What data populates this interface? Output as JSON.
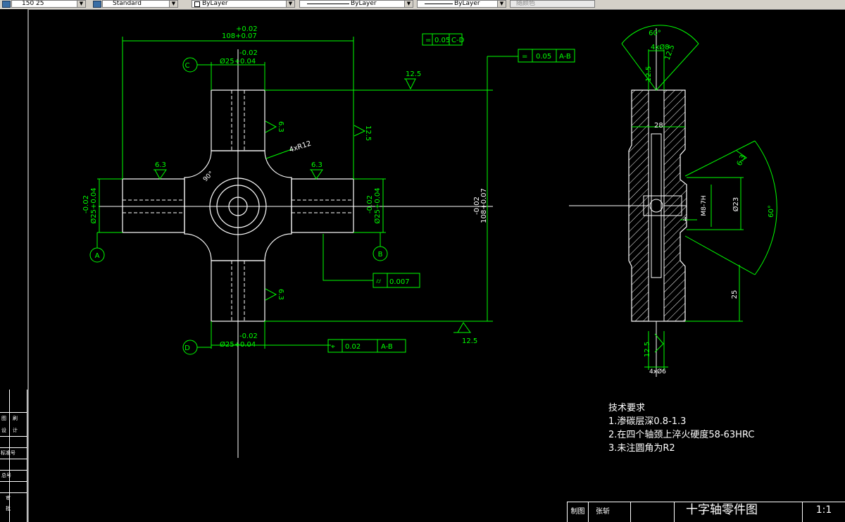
{
  "toolbar": {
    "textstyle_value": "150 25",
    "dimstyle_value": "Standard",
    "layer_value": "ByLayer",
    "linetype_value": "ByLayer",
    "lineweight_value": "ByLayer",
    "color_value": "随颜色"
  },
  "sidebar": {
    "labels": [
      "图",
      "刷",
      "设",
      "计",
      "标准号",
      "总号",
      "审",
      "批"
    ]
  },
  "front_view": {
    "total_width_tol": "+0.02",
    "total_width": "108+0.07",
    "flatness_symbol": "=",
    "flatness_tol": "0.05",
    "flatness_ref": "C-D",
    "top_dia_tol": "-0.02",
    "top_dia": "Ø25+0.04",
    "label_c": "C",
    "right_flatness_symbol": "=",
    "right_flatness_tol": "0.05",
    "right_flatness_ref": "A-B",
    "rough_125_top": "12.5",
    "rough_63_top": "6.3",
    "rough_125_right": "12.5",
    "fillet": "4xR12",
    "rough_63_left": "6.3",
    "rough_63_right": "6.3",
    "angle": "90°",
    "left_dia_tol": "-0.02",
    "left_dia": "Ø25+0.04",
    "right_dia_tol": "-0.02",
    "right_dia": "Ø25+0.04",
    "height_tol": "-0.02",
    "height": "108+0.07",
    "label_a": "A",
    "label_b": "B",
    "cyl_tol": "0.007",
    "rough_63_bottom": "6.3",
    "rough_125_bottom": "12.5",
    "label_d": "D",
    "bottom_dia_tol": "-0.02",
    "bottom_dia": "Ø25+0.04",
    "pos_tol": "0.02",
    "pos_ref": "A-B"
  },
  "side_view": {
    "top_angle": "60°",
    "top_holes": "4xØ8",
    "rough_125_a": "12.5",
    "rough_125_b": "12.5",
    "dim_28": "28",
    "rough_63": "6.3",
    "angle_60": "60°",
    "thread": "M8-7H",
    "dia_23": "Ø23",
    "dim_4": "4",
    "dim_25": "25",
    "rough_125_c": "12.5",
    "bottom_holes": "4xØ6"
  },
  "notes": {
    "title": "技术要求",
    "lines": [
      "1.渗碳层深0.8-1.3",
      "2.在四个轴颈上淬火硬度58-63HRC",
      "3.未注圆角为R2"
    ]
  },
  "title_block": {
    "drawn": "制图",
    "checked": "张斩",
    "name": "十字轴零件图",
    "scale": "1:1"
  }
}
